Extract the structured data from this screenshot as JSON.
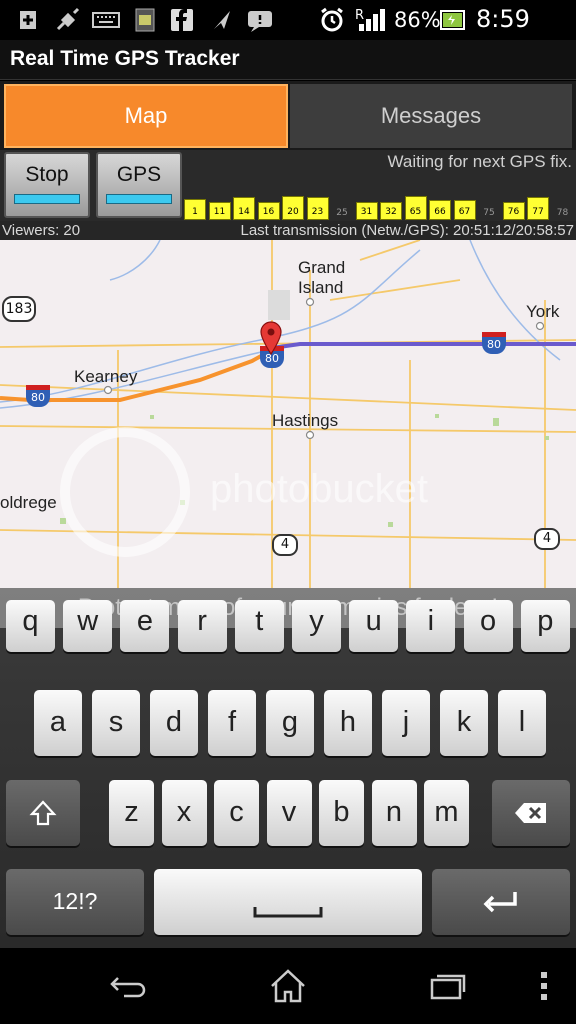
{
  "status_bar": {
    "battery": "86%",
    "time": "8:59 pm",
    "roaming": "R",
    "icons": [
      "add-icon",
      "satellite-icon",
      "keyboard-icon",
      "sim-icon",
      "facebook-icon",
      "navigation-icon",
      "voicemail-icon",
      "alarm-icon",
      "signal-icon",
      "battery-icon"
    ]
  },
  "app": {
    "title": "Real Time GPS Tracker"
  },
  "tabs": [
    {
      "label": "Map"
    },
    {
      "label": "Messages"
    }
  ],
  "controls": {
    "stop_label": "Stop",
    "gps_label": "GPS",
    "status": "Waiting for next GPS fix."
  },
  "signal_bars": [
    {
      "label": "1",
      "level": 0.7
    },
    {
      "label": "11",
      "level": 0.6
    },
    {
      "label": "14",
      "level": 0.75
    },
    {
      "label": "16",
      "level": 0.6
    },
    {
      "label": "20",
      "level": 0.8
    },
    {
      "label": "23",
      "level": 0.75
    },
    {
      "label": "25",
      "level": 0
    },
    {
      "label": "31",
      "level": 0.6
    },
    {
      "label": "32",
      "level": 0.6
    },
    {
      "label": "65",
      "level": 0.8
    },
    {
      "label": "66",
      "level": 0.65
    },
    {
      "label": "67",
      "level": 0.65
    },
    {
      "label": "75",
      "level": 0
    },
    {
      "label": "76",
      "level": 0.6
    },
    {
      "label": "77",
      "level": 0.75
    },
    {
      "label": "78",
      "level": 0
    }
  ],
  "info": {
    "viewers": "Viewers: 20",
    "last_transmission": "Last transmission (Netw./GPS): 20:51:12/20:58:57"
  },
  "map": {
    "cities": {
      "grand_island_1": "Grand",
      "grand_island_2": "Island",
      "york": "York",
      "kearney": "Kearney",
      "hastings": "Hastings",
      "holdrege": "oldrege"
    },
    "shields": {
      "us183": "183",
      "i80_a": "80",
      "i80_b": "80",
      "i80_c": "80",
      "rt4_a": "4",
      "rt4_b": "4"
    },
    "watermark": "photobucket"
  },
  "keyboard": {
    "banner": "Protect more of your memories for less!",
    "row1": [
      "q",
      "w",
      "e",
      "r",
      "t",
      "y",
      "u",
      "i",
      "o",
      "p"
    ],
    "row2": [
      "a",
      "s",
      "d",
      "f",
      "g",
      "h",
      "j",
      "k",
      "l"
    ],
    "row3": [
      "z",
      "x",
      "c",
      "v",
      "b",
      "n",
      "m"
    ],
    "symbols_label": "12!?",
    "space_label": "",
    "shift_icon": "shift-icon",
    "backspace_icon": "backspace-icon",
    "enter_icon": "enter-icon"
  },
  "navbar": {
    "icons": [
      "back-icon",
      "home-icon",
      "recent-apps-icon",
      "menu-icon"
    ]
  },
  "colors": {
    "accent": "#f7892b",
    "gps_bar": "#3cc9ef",
    "signal_bar": "#ffff33",
    "route": "#f7932d",
    "route_ahead": "#6a5acd"
  }
}
